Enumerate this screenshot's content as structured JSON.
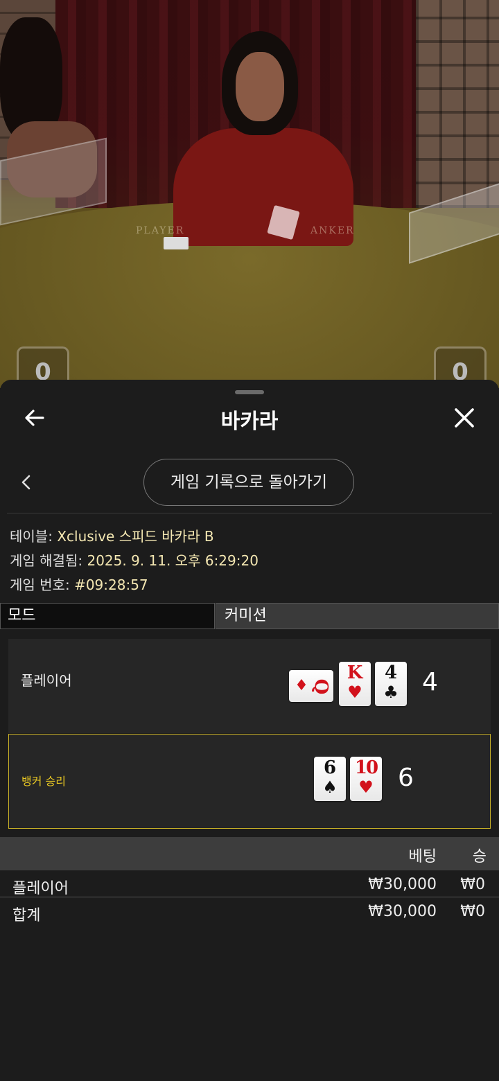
{
  "video": {
    "felt_player": "PLAYER",
    "felt_banker": "ANKER",
    "player_score": "0",
    "banker_score": "0"
  },
  "header": {
    "title": "바카라",
    "back_icon": "arrow-left-icon",
    "close_icon": "close-icon"
  },
  "history": {
    "back_label": "게임 기록으로 돌아가기"
  },
  "info": {
    "table_label": "테이블:",
    "table_value": "Xclusive 스피드 바카라 B",
    "resolved_label": "게임 해결됨:",
    "resolved_value": "2025. 9. 11. 오후 6:29:20",
    "number_label": "게임 번호:",
    "number_value": "#09:28:57"
  },
  "tabs": {
    "mode": "모드",
    "commission": "커미션"
  },
  "result": {
    "player": {
      "label": "플레이어",
      "total": "4",
      "cards": [
        {
          "rank": "Q",
          "suit": "♦",
          "color": "red",
          "sideways": true
        },
        {
          "rank": "K",
          "suit": "♥",
          "color": "red",
          "sideways": false
        },
        {
          "rank": "4",
          "suit": "♣",
          "color": "black",
          "sideways": false
        }
      ]
    },
    "banker": {
      "label": "뱅커 승리",
      "total": "6",
      "cards": [
        {
          "rank": "6",
          "suit": "♠",
          "color": "black",
          "sideways": false
        },
        {
          "rank": "10",
          "suit": "♥",
          "color": "red",
          "sideways": false
        }
      ]
    },
    "win_color": "#c9b127"
  },
  "bets": {
    "header_bet": "베팅",
    "header_win": "승",
    "rows": [
      {
        "name": "플레이어",
        "bet": "₩30,000",
        "win": "₩0"
      }
    ],
    "total": {
      "name": "합계",
      "bet": "₩30,000",
      "win": "₩0"
    }
  }
}
